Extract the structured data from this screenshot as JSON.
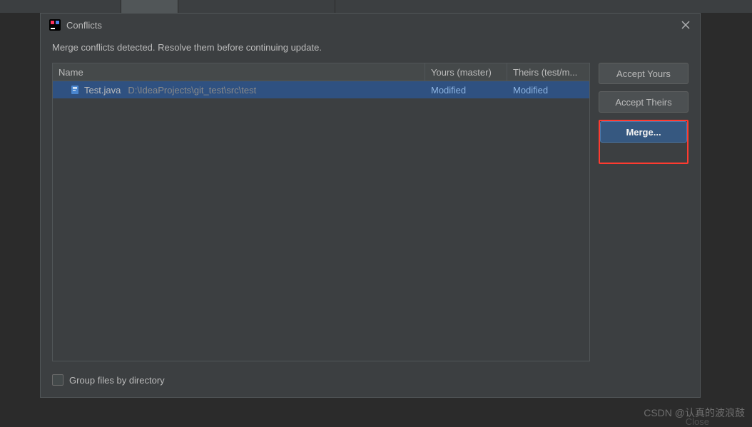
{
  "dialog": {
    "title": "Conflicts",
    "message": "Merge conflicts detected. Resolve them before continuing update."
  },
  "table": {
    "headers": {
      "name": "Name",
      "yours": "Yours (master)",
      "theirs": "Theirs (test/m..."
    },
    "rows": [
      {
        "filename": "Test.java",
        "path": "D:\\IdeaProjects\\git_test\\src\\test",
        "yours": "Modified",
        "theirs": "Modified"
      }
    ]
  },
  "buttons": {
    "accept_yours": "Accept Yours",
    "accept_theirs": "Accept Theirs",
    "merge": "Merge..."
  },
  "checkbox": {
    "group_files": "Group files by directory"
  },
  "watermark": "CSDN @认真的波浪鼓",
  "close_label": "Close"
}
